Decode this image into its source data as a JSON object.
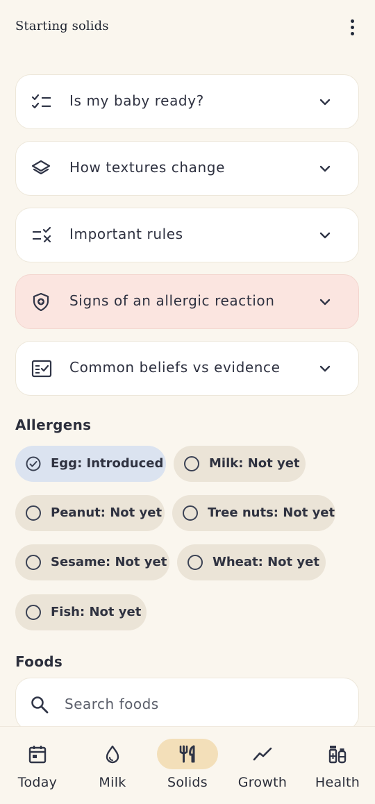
{
  "header": {
    "title": "Starting solids",
    "more_icon": "more-vert-icon"
  },
  "guides": [
    {
      "label": "Is my baby ready?",
      "icon": "checklist-icon"
    },
    {
      "label": "How textures change",
      "icon": "layers-icon"
    },
    {
      "label": "Important rules",
      "icon": "rule-icon"
    },
    {
      "label": "Signs of an allergic reaction",
      "icon": "shield-plus-icon"
    },
    {
      "label": "Common beliefs vs evidence",
      "icon": "fact-check-icon"
    }
  ],
  "allergens": {
    "title": "Allergens",
    "items": [
      {
        "label": "Egg: Introduced",
        "introduced": true
      },
      {
        "label": "Milk: Not yet",
        "introduced": false
      },
      {
        "label": "Peanut: Not yet",
        "introduced": false
      },
      {
        "label": "Tree nuts: Not yet",
        "introduced": false
      },
      {
        "label": "Sesame: Not yet",
        "introduced": false
      },
      {
        "label": "Wheat: Not yet",
        "introduced": false
      },
      {
        "label": "Fish: Not yet",
        "introduced": false
      }
    ]
  },
  "foods": {
    "title": "Foods",
    "search_placeholder": "Search foods"
  },
  "nav": {
    "items": [
      {
        "label": "Today",
        "icon": "calendar-icon"
      },
      {
        "label": "Milk",
        "icon": "drop-icon"
      },
      {
        "label": "Solids",
        "icon": "utensils-icon",
        "active": true
      },
      {
        "label": "Growth",
        "icon": "trend-icon"
      },
      {
        "label": "Health",
        "icon": "medicine-icon"
      }
    ]
  },
  "colors": {
    "background": "#faf6ee",
    "alert_card": "#fbe5e0",
    "chip_introduced": "#dbe3f0",
    "chip_default": "#ebe4d7",
    "nav_active": "#f3dfb9"
  }
}
